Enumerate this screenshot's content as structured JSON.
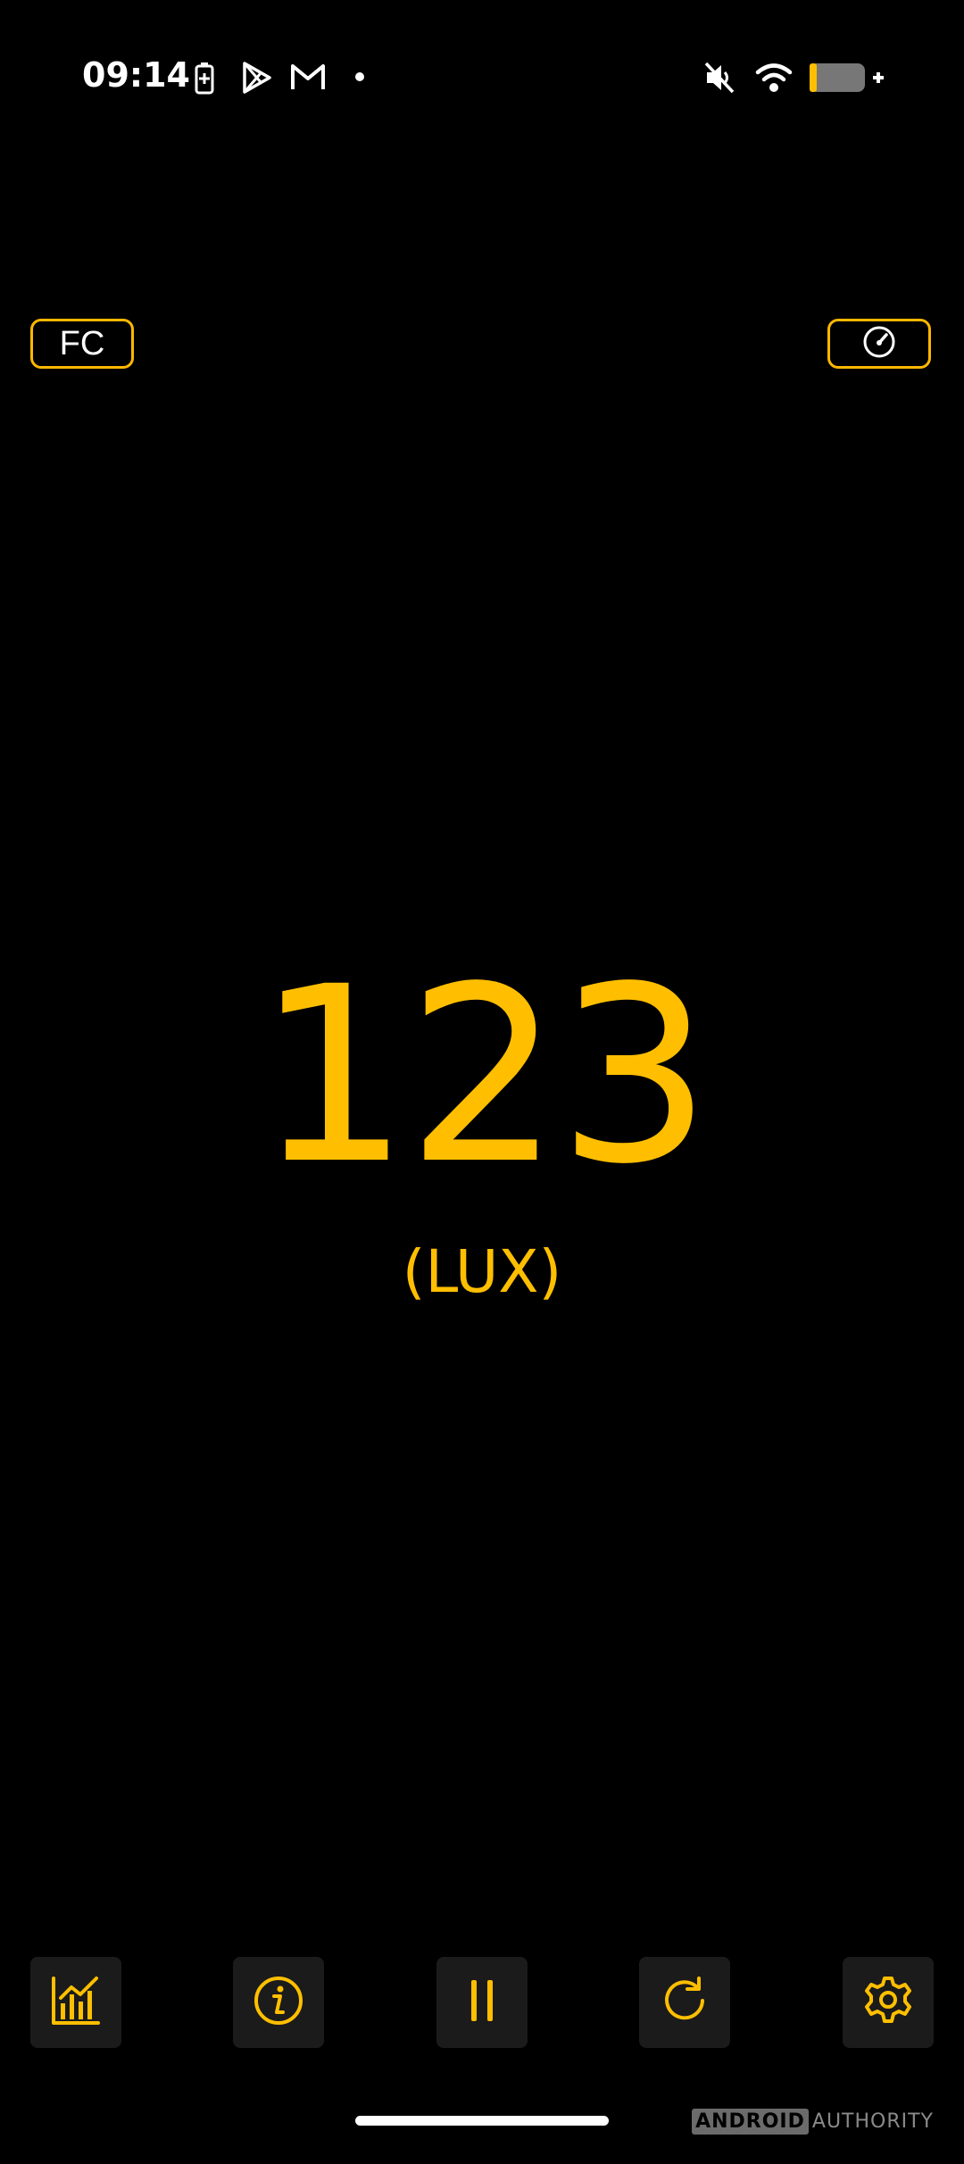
{
  "status_bar": {
    "time": "09:14",
    "left_icons": [
      "battery-saver-icon",
      "play-store-icon",
      "gmail-icon",
      "notification-dot-icon"
    ],
    "right_icons": [
      "mute-icon",
      "wifi-icon",
      "battery-charging-icon"
    ]
  },
  "toolbar": {
    "unit_toggle_label": "FC",
    "gauge_icon": "gauge-icon"
  },
  "meter": {
    "value": "123",
    "unit": "(LUX)"
  },
  "bottom_bar": {
    "buttons": [
      "chart-icon",
      "info-icon",
      "pause-icon",
      "refresh-icon",
      "settings-icon"
    ]
  },
  "watermark": {
    "part1": "ANDROID",
    "part2": "AUTHORITY"
  },
  "colors": {
    "accent": "#FFBF00",
    "background": "#000000",
    "button_bg": "#1B1B1B"
  }
}
